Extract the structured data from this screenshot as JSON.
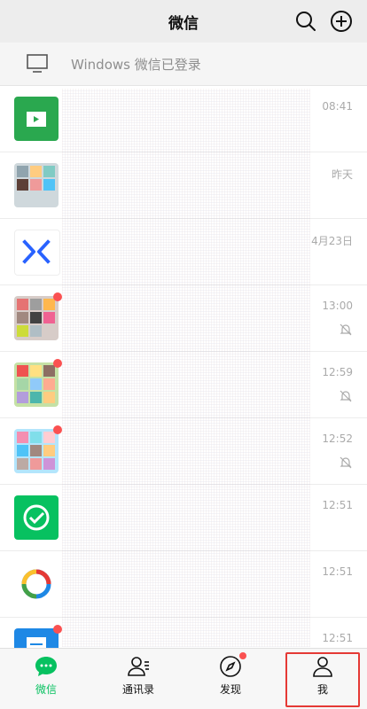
{
  "header": {
    "title": "微信"
  },
  "banner": {
    "text": "Windows 微信已登录"
  },
  "chats": [
    {
      "time": "08:41",
      "avatar_color": "#2aa84f",
      "dot": false,
      "muted": false
    },
    {
      "time": "昨天",
      "avatar_color": "#cfd8dc",
      "dot": false,
      "muted": false
    },
    {
      "time": "4月23日",
      "avatar_color": "#ffffff",
      "dot": false,
      "muted": false
    },
    {
      "time": "13:00",
      "avatar_color": "#d7ccc8",
      "dot": true,
      "muted": true
    },
    {
      "time": "12:59",
      "avatar_color": "#c5e1a5",
      "dot": true,
      "muted": true
    },
    {
      "time": "12:52",
      "avatar_color": "#b3e5fc",
      "dot": true,
      "muted": true
    },
    {
      "time": "12:51",
      "avatar_color": "#07c160",
      "dot": false,
      "muted": false
    },
    {
      "time": "12:51",
      "avatar_color": "#ffffff",
      "dot": false,
      "muted": false
    },
    {
      "time": "12:51",
      "avatar_color": "#1e88e5",
      "dot": true,
      "muted": false
    }
  ],
  "tabs": [
    {
      "label": "微信"
    },
    {
      "label": "通讯录"
    },
    {
      "label": "发现"
    },
    {
      "label": "我"
    }
  ],
  "colors": {
    "accent": "#07c160",
    "badge": "#fa5151",
    "highlight_box": "#e53935"
  }
}
